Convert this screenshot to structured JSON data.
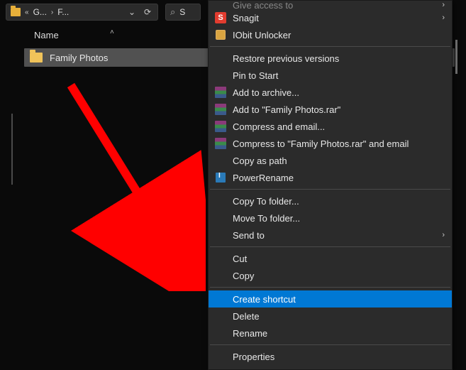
{
  "toolbar": {
    "breadcrumb_parts": [
      "G...",
      "F..."
    ],
    "breadcrumb_prefix": "«",
    "breadcrumb_sep": "›",
    "search_placeholder": "S"
  },
  "columns": {
    "name": "Name"
  },
  "files": [
    {
      "name": "Family Photos",
      "type": "folder",
      "selected": true
    }
  ],
  "context_menu": {
    "items": [
      {
        "id": "give-access",
        "label": "Give access to",
        "icon": null,
        "submenu": true,
        "truncated_top": true
      },
      {
        "id": "snagit",
        "label": "Snagit",
        "icon": "snagit",
        "submenu": true
      },
      {
        "id": "iobit-unlocker",
        "label": "IObit Unlocker",
        "icon": "iobit",
        "submenu": false
      },
      {
        "sep": true
      },
      {
        "id": "restore-previous",
        "label": "Restore previous versions",
        "icon": null,
        "submenu": false
      },
      {
        "id": "pin-start",
        "label": "Pin to Start",
        "icon": null,
        "submenu": false
      },
      {
        "id": "add-archive",
        "label": "Add to archive...",
        "icon": "rar",
        "submenu": false
      },
      {
        "id": "add-to-rar",
        "label": "Add to \"Family Photos.rar\"",
        "icon": "rar",
        "submenu": false
      },
      {
        "id": "compress-email",
        "label": "Compress and email...",
        "icon": "rar",
        "submenu": false
      },
      {
        "id": "compress-rar-email",
        "label": "Compress to \"Family Photos.rar\" and email",
        "icon": "rar",
        "submenu": false
      },
      {
        "id": "copy-as-path",
        "label": "Copy as path",
        "icon": null,
        "submenu": false
      },
      {
        "id": "power-rename",
        "label": "PowerRename",
        "icon": "rename",
        "submenu": false
      },
      {
        "sep": true
      },
      {
        "id": "copy-to-folder",
        "label": "Copy To folder...",
        "icon": null,
        "submenu": false
      },
      {
        "id": "move-to-folder",
        "label": "Move To folder...",
        "icon": null,
        "submenu": false
      },
      {
        "id": "send-to",
        "label": "Send to",
        "icon": null,
        "submenu": true
      },
      {
        "sep": true
      },
      {
        "id": "cut",
        "label": "Cut",
        "icon": null,
        "submenu": false
      },
      {
        "id": "copy",
        "label": "Copy",
        "icon": null,
        "submenu": false
      },
      {
        "sep": true
      },
      {
        "id": "create-shortcut",
        "label": "Create shortcut",
        "icon": null,
        "submenu": false,
        "highlighted": true
      },
      {
        "id": "delete",
        "label": "Delete",
        "icon": null,
        "submenu": false
      },
      {
        "id": "rename",
        "label": "Rename",
        "icon": null,
        "submenu": false
      },
      {
        "sep": true
      },
      {
        "id": "properties",
        "label": "Properties",
        "icon": null,
        "submenu": false
      }
    ]
  }
}
